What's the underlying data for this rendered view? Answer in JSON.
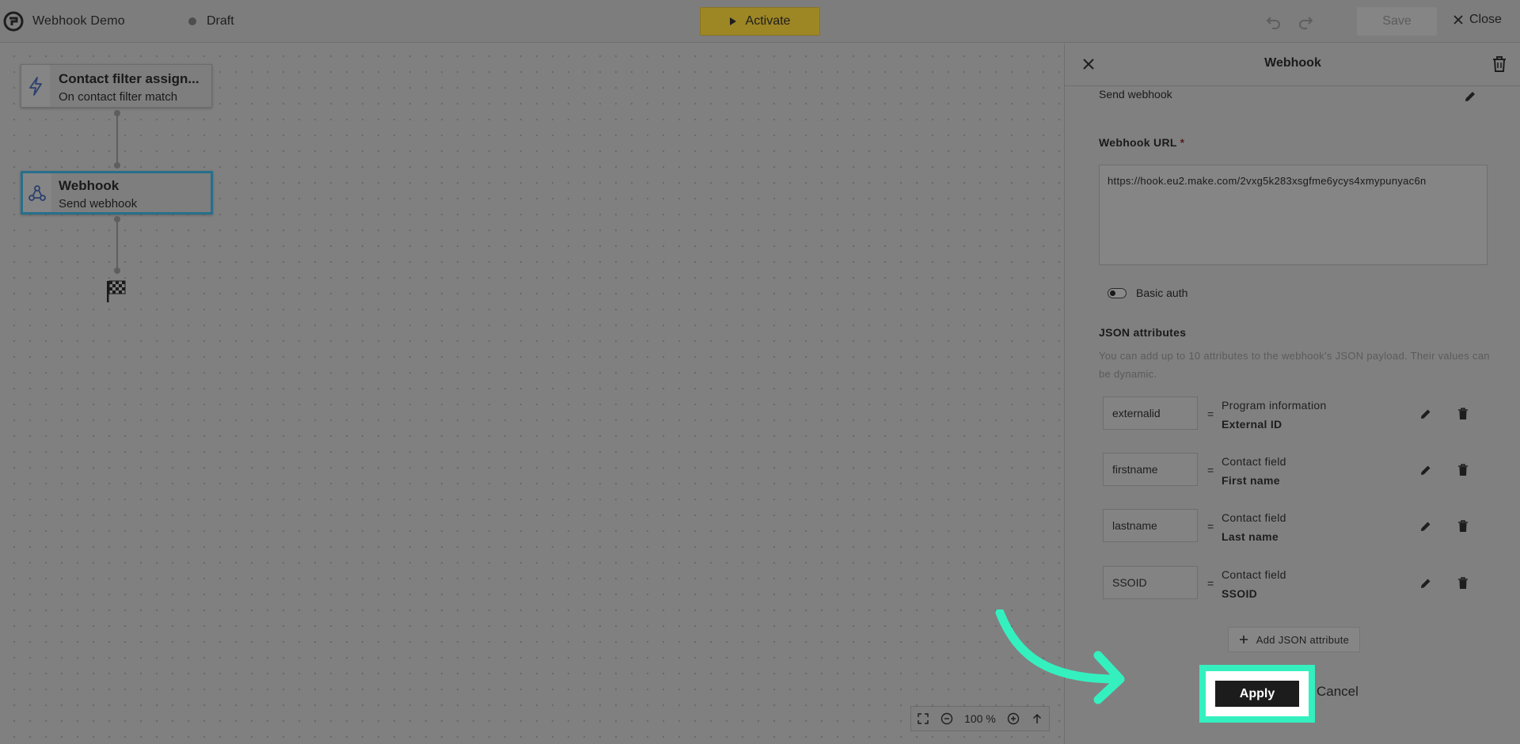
{
  "header": {
    "app_title": "Webhook Demo",
    "status": "Draft",
    "activate_label": "Activate",
    "save_label": "Save",
    "close_label": "Close"
  },
  "canvas": {
    "nodes": [
      {
        "title": "Contact filter assign...",
        "subtitle": "On contact filter match",
        "icon": "lightning-icon"
      },
      {
        "title": "Webhook",
        "subtitle": "Send webhook",
        "icon": "webhook-icon"
      }
    ],
    "end_icon": "finish-flag-icon",
    "zoom": "100 %"
  },
  "panel": {
    "title": "Webhook",
    "step_name": "Send webhook",
    "url_label": "Webhook URL",
    "url_required": "*",
    "url_value": "https://hook.eu2.make.com/2vxg5k283xsgfme6ycys4xmypunyac6n",
    "basic_auth_label": "Basic auth",
    "basic_auth_enabled": false,
    "json_label": "JSON attributes",
    "json_helper": "You can add up to 10 attributes to the webhook's JSON payload. Their values can be dynamic.",
    "attributes": [
      {
        "key": "externalid",
        "eq": "=",
        "source": "Program information",
        "field": "External ID"
      },
      {
        "key": "firstname",
        "eq": "=",
        "source": "Contact field",
        "field": "First name"
      },
      {
        "key": "lastname",
        "eq": "=",
        "source": "Contact field",
        "field": "Last name"
      },
      {
        "key": "SSOID",
        "eq": "=",
        "source": "Contact field",
        "field": "SSOID"
      }
    ],
    "add_attr_label": "Add JSON attribute",
    "apply_label": "Apply",
    "cancel_label": "Cancel"
  },
  "colors": {
    "highlight": "#34f0bf",
    "node_selected": "#276f8c",
    "activate": "#9d8624"
  }
}
